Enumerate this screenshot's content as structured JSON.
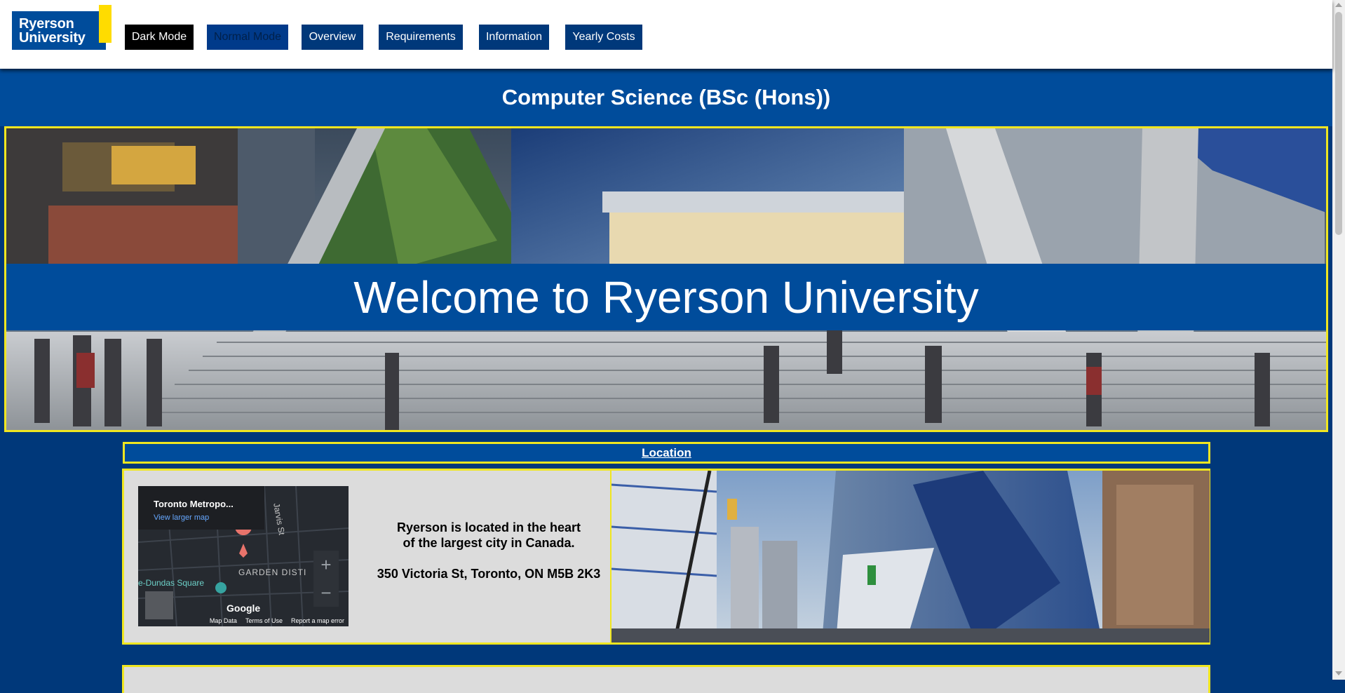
{
  "logo": {
    "line1": "Ryerson",
    "line2": "University"
  },
  "nav": {
    "dark_mode": "Dark Mode",
    "normal_mode": "Normal Mode",
    "overview": "Overview",
    "requirements": "Requirements",
    "information": "Information",
    "yearly_costs": "Yearly Costs"
  },
  "page_title": "Computer Science (BSc (Hons))",
  "hero": {
    "banner": "Welcome to Ryerson University"
  },
  "location": {
    "heading": "Location",
    "description": "Ryerson is located in the heart of the largest city in Canada.",
    "address": "350 Victoria St, Toronto, ON M5B 2K3",
    "map": {
      "place_name": "Toronto Metropo...",
      "view_larger": "View larger map",
      "zoom_in": "+",
      "zoom_out": "−",
      "label_district": "GARDEN DISTI",
      "label_square": "e-Dundas Square",
      "label_street": "Jarvis St",
      "brand": "Google",
      "footer_map_data": "Map Data",
      "footer_terms": "Terms of Use",
      "footer_report": "Report a map error"
    }
  },
  "colors": {
    "brand_blue": "#004c9b",
    "dark_blue": "#00387a",
    "accent_yellow": "#f0e620",
    "panel_grey": "#dcdcdc"
  }
}
